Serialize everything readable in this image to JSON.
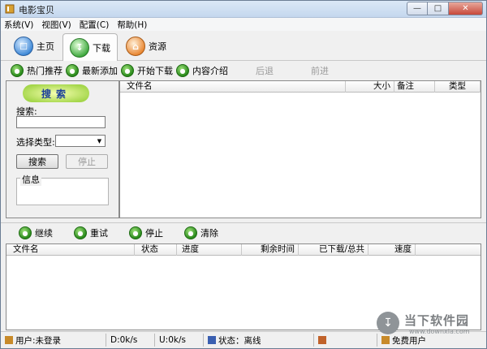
{
  "window": {
    "title": "电影宝贝",
    "minimize_icon": "minimize-icon",
    "maximize_icon": "maximize-icon",
    "close_icon": "close-icon"
  },
  "menu": [
    "系统(V)",
    "视图(V)",
    "配置(C)",
    "帮助(H)"
  ],
  "tabs": [
    {
      "label": "主页",
      "icon": "home-icon",
      "color": "#3a86d6"
    },
    {
      "label": "下载",
      "icon": "download-icon",
      "color": "#3aa63a"
    },
    {
      "label": "资源",
      "icon": "resource-icon",
      "color": "#e8842d"
    }
  ],
  "toolbar": [
    {
      "label": "热门推荐",
      "disabled": false
    },
    {
      "label": "最新添加",
      "disabled": false
    },
    {
      "label": "开始下载",
      "disabled": false
    },
    {
      "label": "内容介绍",
      "disabled": false
    },
    {
      "label": "后退",
      "disabled": true
    },
    {
      "label": "前进",
      "disabled": true
    }
  ],
  "search_panel": {
    "banner": "搜索",
    "search_label": "搜索:",
    "search_value": "",
    "type_label": "选择类型:",
    "type_value": "",
    "search_button": "搜索",
    "stop_button": "停止",
    "info_label": "信息",
    "info_value": ""
  },
  "file_list": {
    "headers": [
      "文件名",
      "大小",
      "备注",
      "类型"
    ],
    "rows": []
  },
  "task_toolbar": [
    "继续",
    "重试",
    "停止",
    "清除"
  ],
  "task_list": {
    "headers": [
      "文件名",
      "状态",
      "进度",
      "剩余时间",
      "已下载/总共",
      "速度"
    ],
    "rows": []
  },
  "statusbar": {
    "user": "用户:未登录",
    "down_speed": "D:0k/s",
    "up_speed": "U:0k/s",
    "status": "状态：离线",
    "free_user": "免费用户"
  },
  "watermark": {
    "text": "当下软件园",
    "url": "www.downxia.com"
  },
  "colors": {
    "accent_green": "#2a8a1c",
    "title_bar": "#c4d7ee",
    "close_button": "#c7483a"
  }
}
